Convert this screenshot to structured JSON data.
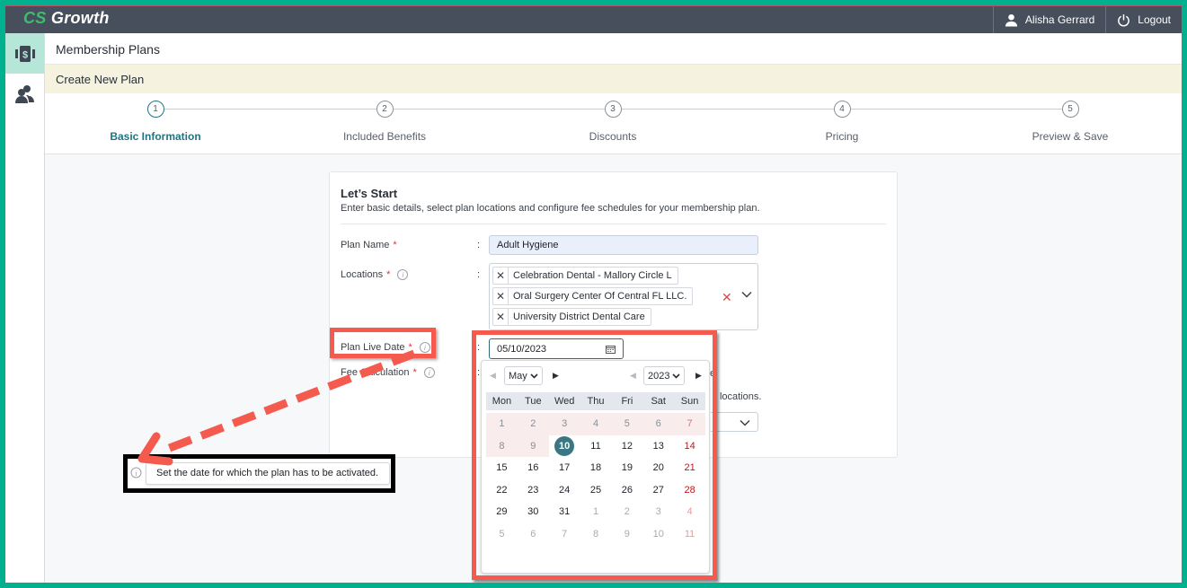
{
  "app": {
    "logo_prefix": "CS",
    "logo_suffix": " Growth",
    "user_name": "Alisha Gerrard",
    "logout_label": "Logout",
    "accent_color": "#1f7480",
    "frame_color": "#00b08f"
  },
  "sidebar": {
    "items": [
      {
        "name": "membership-plans",
        "icon": "dollar-card-icon",
        "active": true
      },
      {
        "name": "patients",
        "icon": "users-icon",
        "active": false
      }
    ]
  },
  "page": {
    "title": "Membership Plans",
    "subtitle": "Create New Plan"
  },
  "stepper": {
    "steps": [
      {
        "number": "1",
        "label": "Basic Information",
        "active": true
      },
      {
        "number": "2",
        "label": "Included Benefits",
        "active": false
      },
      {
        "number": "3",
        "label": "Discounts",
        "active": false
      },
      {
        "number": "4",
        "label": "Pricing",
        "active": false
      },
      {
        "number": "5",
        "label": "Preview & Save",
        "active": false
      }
    ]
  },
  "form": {
    "title": "Let’s Start",
    "description": "Enter basic details, select plan locations and configure fee schedules for your membership plan.",
    "colon": ":",
    "required_mark": "*",
    "plan_name": {
      "label": "Plan Name",
      "value": "Adult Hygiene"
    },
    "locations": {
      "label": "Locations",
      "tags": [
        "Celebration Dental - Mallory Circle L",
        "Oral Surgery Center Of Central FL LLC.",
        "University District Dental Care"
      ]
    },
    "plan_live_date": {
      "label": "Plan Live Date",
      "value": "05/10/2023"
    },
    "fee_calculation": {
      "label": "Fee Calculation",
      "label_visible": "Fee",
      "label_visible_end": "ulation"
    },
    "obscured_text_1": "e",
    "obscured_text_2": "ll locations."
  },
  "datepicker": {
    "month": "May",
    "year": "2023",
    "weekdays": [
      "Mon",
      "Tue",
      "Wed",
      "Thu",
      "Fri",
      "Sat",
      "Sun"
    ],
    "weeks": [
      [
        {
          "d": "1",
          "t": "past"
        },
        {
          "d": "2",
          "t": "past"
        },
        {
          "d": "3",
          "t": "past"
        },
        {
          "d": "4",
          "t": "past"
        },
        {
          "d": "5",
          "t": "past"
        },
        {
          "d": "6",
          "t": "past"
        },
        {
          "d": "7",
          "t": "past sun"
        }
      ],
      [
        {
          "d": "8",
          "t": "past"
        },
        {
          "d": "9",
          "t": "past"
        },
        {
          "d": "10",
          "t": "selected"
        },
        {
          "d": "11",
          "t": ""
        },
        {
          "d": "12",
          "t": ""
        },
        {
          "d": "13",
          "t": ""
        },
        {
          "d": "14",
          "t": "sun"
        }
      ],
      [
        {
          "d": "15",
          "t": ""
        },
        {
          "d": "16",
          "t": ""
        },
        {
          "d": "17",
          "t": ""
        },
        {
          "d": "18",
          "t": ""
        },
        {
          "d": "19",
          "t": ""
        },
        {
          "d": "20",
          "t": ""
        },
        {
          "d": "21",
          "t": "sun"
        }
      ],
      [
        {
          "d": "22",
          "t": ""
        },
        {
          "d": "23",
          "t": ""
        },
        {
          "d": "24",
          "t": ""
        },
        {
          "d": "25",
          "t": ""
        },
        {
          "d": "26",
          "t": ""
        },
        {
          "d": "27",
          "t": ""
        },
        {
          "d": "28",
          "t": "sun"
        }
      ],
      [
        {
          "d": "29",
          "t": ""
        },
        {
          "d": "30",
          "t": ""
        },
        {
          "d": "31",
          "t": ""
        },
        {
          "d": "1",
          "t": "other"
        },
        {
          "d": "2",
          "t": "other"
        },
        {
          "d": "3",
          "t": "other"
        },
        {
          "d": "4",
          "t": "other sun"
        }
      ],
      [
        {
          "d": "5",
          "t": "other"
        },
        {
          "d": "6",
          "t": "other"
        },
        {
          "d": "7",
          "t": "other"
        },
        {
          "d": "8",
          "t": "other"
        },
        {
          "d": "9",
          "t": "other"
        },
        {
          "d": "10",
          "t": "other"
        },
        {
          "d": "11",
          "t": "other sun"
        }
      ]
    ],
    "selected_day": "10"
  },
  "annotation": {
    "tooltip_text": "Set the date for which the plan has to be activated.",
    "highlight_color": "#f45b4e"
  }
}
